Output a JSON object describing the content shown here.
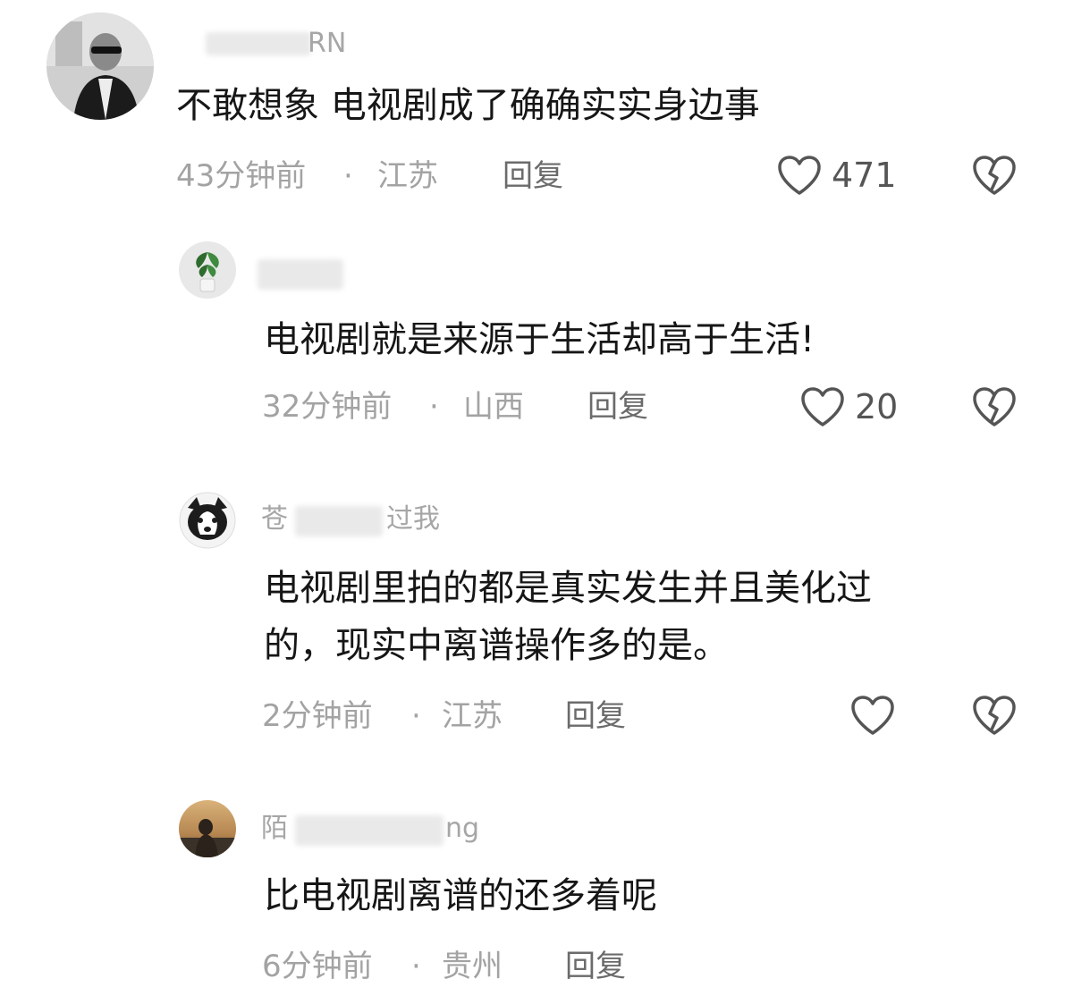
{
  "comments": [
    {
      "username": "RN",
      "content": "不敢想象  电视剧成了确确实实身边事",
      "time": "43分钟前",
      "location": "江苏",
      "reply_label": "回复",
      "likes": "471"
    },
    {
      "username": "",
      "content": "电视剧就是来源于生活却高于生活!",
      "time": "32分钟前",
      "location": "山西",
      "reply_label": "回复",
      "likes": "20"
    },
    {
      "username_prefix": "苍",
      "username_suffix": "过我",
      "content_line1": "电视剧里拍的都是真实发生并且美化过",
      "content_line2": "的，现实中离谱操作多的是。",
      "time": "2分钟前",
      "location": "江苏",
      "reply_label": "回复",
      "likes": ""
    },
    {
      "username_prefix": "陌",
      "username_suffix": "ng",
      "content": "比电视剧离谱的还多着呢",
      "time": "6分钟前",
      "location": "贵州",
      "reply_label": "回复"
    }
  ],
  "separator": "·",
  "icons": {
    "like": "heart-outline-icon",
    "dislike": "broken-heart-icon"
  },
  "colors": {
    "text": "#161616",
    "meta": "#a3a3a3",
    "icon": "#555555"
  }
}
